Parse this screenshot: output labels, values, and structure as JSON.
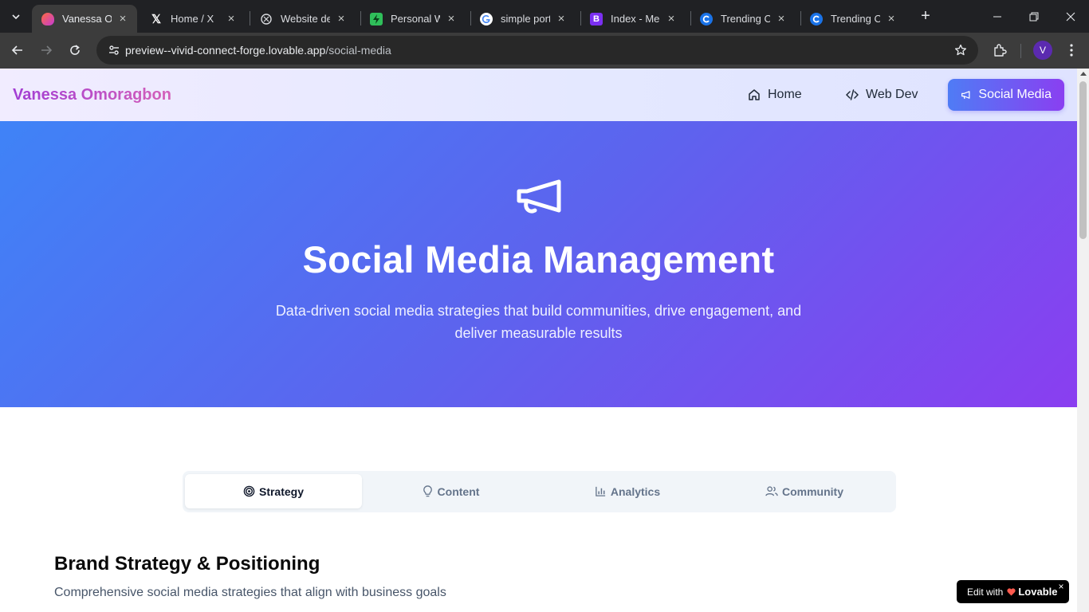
{
  "browser": {
    "tabs": [
      {
        "title": "Vanessa Omoragbon",
        "favicon": "lovable-heart-icon",
        "active": true
      },
      {
        "title": "Home / X",
        "favicon": "x-logo-icon",
        "active": false
      },
      {
        "title": "Website design",
        "favicon": "openai-icon",
        "active": false
      },
      {
        "title": "Personal Website",
        "favicon": "lightning-icon",
        "active": false
      },
      {
        "title": "simple portfolio",
        "favicon": "google-icon",
        "active": false
      },
      {
        "title": "Index - Medium",
        "favicon": "bootstrap-icon",
        "active": false
      },
      {
        "title": "Trending Colors",
        "favicon": "coolors-icon",
        "active": false
      },
      {
        "title": "Trending Colors",
        "favicon": "coolors-icon",
        "active": false
      }
    ],
    "url_host": "preview--vivid-connect-forge.lovable.app",
    "url_path": "/social-media",
    "profile_initial": "V"
  },
  "site": {
    "brand": "Vanessa Omoragbon",
    "nav": [
      {
        "label": "Home",
        "icon": "home-icon",
        "active": false
      },
      {
        "label": "Web Dev",
        "icon": "code-icon",
        "active": false
      },
      {
        "label": "Social Media",
        "icon": "megaphone-icon",
        "active": true
      }
    ]
  },
  "hero": {
    "icon": "megaphone-icon",
    "title": "Social Media Management",
    "subtitle": "Data-driven social media strategies that build communities, drive engagement, and deliver measurable results"
  },
  "tabs": [
    {
      "label": "Strategy",
      "icon": "target-icon",
      "active": true
    },
    {
      "label": "Content",
      "icon": "lightbulb-icon",
      "active": false
    },
    {
      "label": "Analytics",
      "icon": "bar-chart-icon",
      "active": false
    },
    {
      "label": "Community",
      "icon": "users-icon",
      "active": false
    }
  ],
  "section": {
    "title": "Brand Strategy & Positioning",
    "subtitle": "Comprehensive social media strategies that align with business goals"
  },
  "badge": {
    "prefix": "Edit with",
    "brand": "Lovable",
    "close": "×"
  },
  "colors": {
    "brand_gradient": [
      "#a23ed4",
      "#d460b9"
    ],
    "hero_gradient": [
      "#3f83f7",
      "#8a3ef0"
    ],
    "active_nav_gradient": [
      "#4f7cf5",
      "#8a3ff1"
    ]
  }
}
